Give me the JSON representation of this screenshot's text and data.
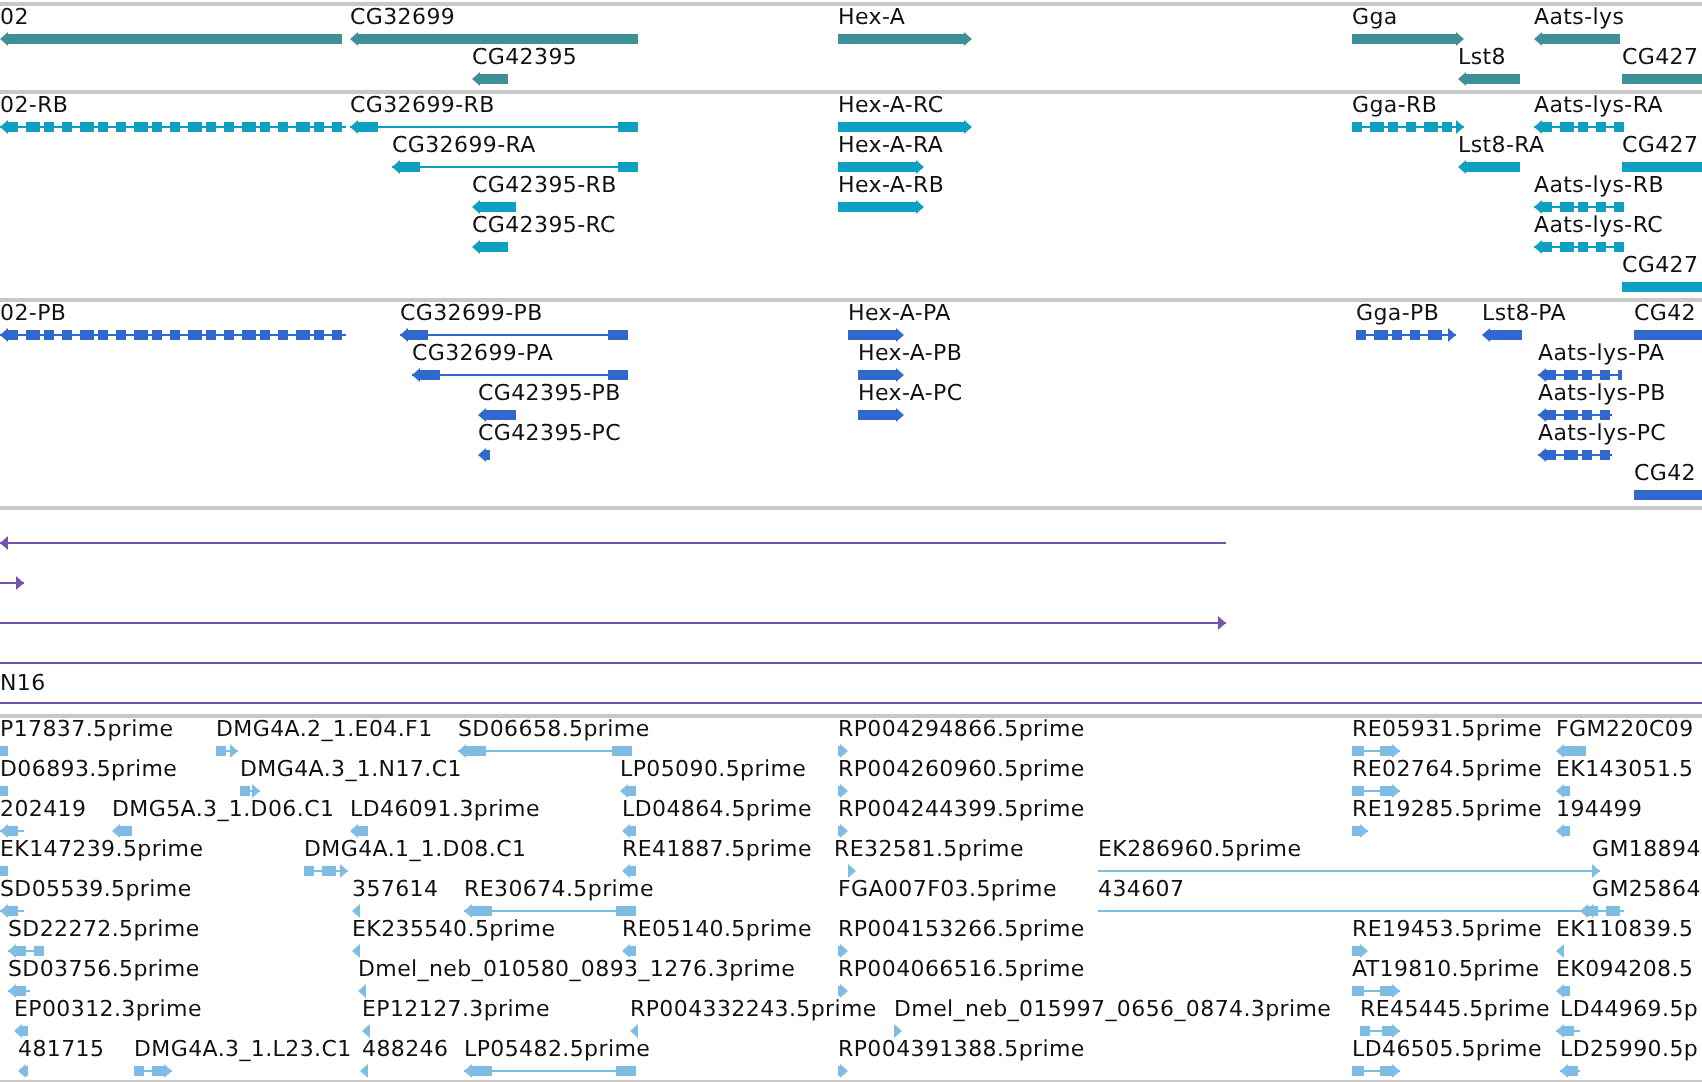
{
  "tracks": [
    {
      "color": "#3f9096",
      "features": [
        {
          "label": "02"
        },
        {
          "label": "CG32699"
        },
        {
          "label": "CG42395"
        },
        {
          "label": "Hex-A"
        },
        {
          "label": "Gga"
        },
        {
          "label": "Lst8"
        },
        {
          "label": "Aats-lys"
        },
        {
          "label": "CG427"
        }
      ]
    },
    {
      "color": "#0ea0c0",
      "features": [
        {
          "label": "02-RB"
        },
        {
          "label": "CG32699-RB"
        },
        {
          "label": "CG32699-RA"
        },
        {
          "label": "CG42395-RB"
        },
        {
          "label": "CG42395-RC"
        },
        {
          "label": "Hex-A-RC"
        },
        {
          "label": "Hex-A-RA"
        },
        {
          "label": "Hex-A-RB"
        },
        {
          "label": "Gga-RB"
        },
        {
          "label": "Lst8-RA"
        },
        {
          "label": "Aats-lys-RA"
        },
        {
          "label": "CG427"
        },
        {
          "label": "Aats-lys-RB"
        },
        {
          "label": "Aats-lys-RC"
        },
        {
          "label": "CG427"
        }
      ]
    },
    {
      "color": "#3168cc",
      "features": [
        {
          "label": "02-PB"
        },
        {
          "label": "CG32699-PB"
        },
        {
          "label": "CG32699-PA"
        },
        {
          "label": "CG42395-PB"
        },
        {
          "label": "CG42395-PC"
        },
        {
          "label": "Hex-A-PA"
        },
        {
          "label": "Hex-A-PB"
        },
        {
          "label": "Hex-A-PC"
        },
        {
          "label": "Gga-PB"
        },
        {
          "label": "Lst8-PA"
        },
        {
          "label": "CG42"
        },
        {
          "label": "Aats-lys-PA"
        },
        {
          "label": "Aats-lys-PB"
        },
        {
          "label": "Aats-lys-PC"
        },
        {
          "label": "CG42"
        }
      ]
    },
    {
      "color": "#7453a8",
      "features": [
        {
          "kind": "line"
        },
        {
          "kind": "line"
        },
        {
          "kind": "line"
        },
        {
          "kind": "line"
        },
        {
          "kind": "line",
          "label": "N16"
        }
      ]
    },
    {
      "color": "#7fbce4",
      "features": [
        {
          "label": "P17837.5prime"
        },
        {
          "label": "DMG4A.2_1.E04.F1"
        },
        {
          "label": "SD06658.5prime"
        },
        {
          "label": "RP004294866.5prime"
        },
        {
          "label": "RE05931.5prime"
        },
        {
          "label": "FGM220C09"
        },
        {
          "label": "D06893.5prime"
        },
        {
          "label": "DMG4A.3_1.N17.C1"
        },
        {
          "label": "LP05090.5prime"
        },
        {
          "label": "RP004260960.5prime"
        },
        {
          "label": "RE02764.5prime"
        },
        {
          "label": "EK143051.5"
        },
        {
          "label": "202419"
        },
        {
          "label": "DMG5A.3_1.D06.C1"
        },
        {
          "label": "LD46091.3prime"
        },
        {
          "label": "LD04864.5prime"
        },
        {
          "label": "RP004244399.5prime"
        },
        {
          "label": "RE19285.5prime"
        },
        {
          "label": "194499"
        },
        {
          "label": "EK147239.5prime"
        },
        {
          "label": "DMG4A.1_1.D08.C1"
        },
        {
          "label": "RE41887.5prime"
        },
        {
          "label": "RE32581.5prime"
        },
        {
          "label": "EK286960.5prime"
        },
        {
          "label": "GM18894"
        },
        {
          "label": "SD05539.5prime"
        },
        {
          "label": "357614"
        },
        {
          "label": "RE30674.5prime"
        },
        {
          "label": "FGA007F03.5prime"
        },
        {
          "label": "434607"
        },
        {
          "label": "GM25864"
        },
        {
          "label": "SD22272.5prime"
        },
        {
          "label": "EK235540.5prime"
        },
        {
          "label": "RE05140.5prime"
        },
        {
          "label": "RP004153266.5prime"
        },
        {
          "label": "RE19453.5prime"
        },
        {
          "label": "EK110839.5"
        },
        {
          "label": "SD03756.5prime"
        },
        {
          "label": "Dmel_neb_010580_0893_1276.3prime"
        },
        {
          "label": "RP004066516.5prime"
        },
        {
          "label": "AT19810.5prime"
        },
        {
          "label": "EK094208.5"
        },
        {
          "label": "EP00312.3prime"
        },
        {
          "label": "EP12127.3prime"
        },
        {
          "label": "RP004332243.5prime"
        },
        {
          "label": "Dmel_neb_015997_0656_0874.3prime"
        },
        {
          "label": "RE45445.5prime"
        },
        {
          "label": "LD44969.5p"
        },
        {
          "label": "481715"
        },
        {
          "label": "DMG4A.3_1.L23.C1"
        },
        {
          "label": "488246"
        },
        {
          "label": "LP05482.5prime"
        },
        {
          "label": "RP004391388.5prime"
        },
        {
          "label": "LD46505.5prime"
        },
        {
          "label": "LD25990.5p"
        }
      ]
    }
  ]
}
